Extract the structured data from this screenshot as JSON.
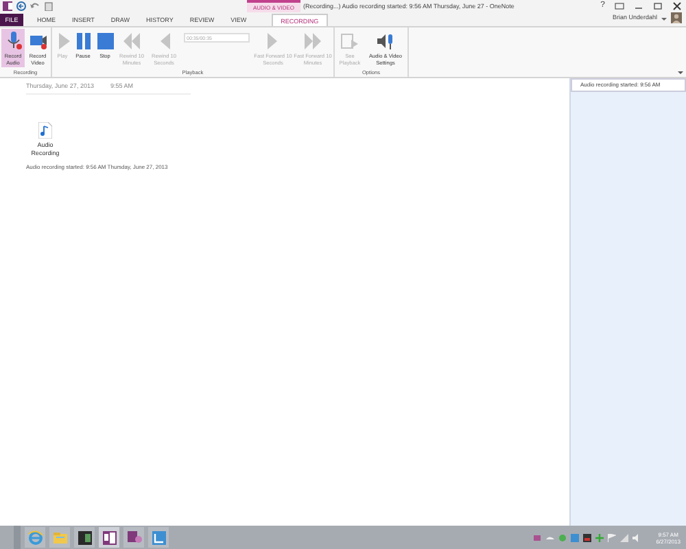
{
  "title_bar": {
    "context_tab": "AUDIO & VIDEO",
    "title": "(Recording...) Audio recording started: 9:56 AM Thursday, June 27 - OneNote",
    "help": "?"
  },
  "tabs": [
    {
      "label": "FILE",
      "kind": "file",
      "selected": false
    },
    {
      "label": "HOME",
      "kind": "tab",
      "selected": false
    },
    {
      "label": "INSERT",
      "kind": "tab",
      "selected": false
    },
    {
      "label": "DRAW",
      "kind": "tab",
      "selected": false
    },
    {
      "label": "HISTORY",
      "kind": "tab",
      "selected": false
    },
    {
      "label": "REVIEW",
      "kind": "tab",
      "selected": false
    },
    {
      "label": "VIEW",
      "kind": "tab",
      "selected": false
    },
    {
      "label": "RECORDING",
      "kind": "context",
      "selected": true
    }
  ],
  "account": {
    "name": "Brian Underdahl"
  },
  "ribbon_groups": [
    {
      "label": "Recording",
      "buttons": [
        {
          "kind": "record-audio",
          "label": "Record Audio",
          "selected": true,
          "disabled": false
        },
        {
          "kind": "record-video",
          "label": "Record Video",
          "selected": false,
          "disabled": false
        }
      ]
    },
    {
      "label": "Playback",
      "buttons": [
        {
          "kind": "play",
          "label": "Play",
          "selected": false,
          "disabled": true
        },
        {
          "kind": "pause",
          "label": "Pause",
          "selected": false,
          "disabled": false
        },
        {
          "kind": "stop",
          "label": "Stop",
          "selected": false,
          "disabled": false
        },
        {
          "kind": "rewind-far",
          "label": "Rewind 10 Minutes",
          "selected": false,
          "disabled": true
        },
        {
          "kind": "rewind",
          "label": "Rewind 10 Seconds",
          "selected": false,
          "disabled": true
        },
        {
          "kind": "time",
          "value": "00:35/00:35"
        },
        {
          "kind": "forward",
          "label": "Fast Forward 10 Seconds",
          "selected": false,
          "disabled": true
        },
        {
          "kind": "forward-far",
          "label": "Fast Forward 10 Minutes",
          "selected": false,
          "disabled": true
        }
      ]
    },
    {
      "label": "Options",
      "buttons": [
        {
          "kind": "see-playback",
          "label": "See Playback",
          "selected": false,
          "disabled": true
        },
        {
          "kind": "settings",
          "label": "Audio & Video Settings",
          "selected": false,
          "disabled": false
        }
      ]
    }
  ],
  "page": {
    "date": "Thursday, June 27, 2013",
    "time": "9:55 AM",
    "attachment": "Audio Recording",
    "caption": "Audio recording started: 9:56 AM Thursday, June 27, 2013"
  },
  "page_list": [
    {
      "title": "Audio recording started: 9:56 AM",
      "selected": true
    }
  ],
  "taskbar": {
    "apps": [
      {
        "kind": "ie",
        "selected": false
      },
      {
        "kind": "explorer",
        "selected": false
      },
      {
        "kind": "app",
        "selected": false
      },
      {
        "kind": "onenote",
        "selected": true
      },
      {
        "kind": "onenote-alt",
        "selected": false
      },
      {
        "kind": "lync",
        "selected": false
      }
    ],
    "time": "9:57 AM",
    "date": "6/27/2013"
  }
}
